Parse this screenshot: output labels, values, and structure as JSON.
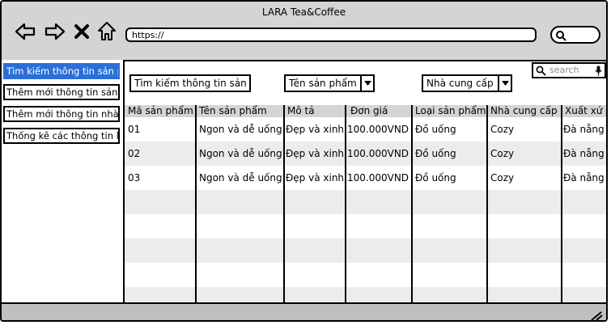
{
  "window": {
    "title": "LARA Tea&Coffee"
  },
  "toolbar": {
    "back_icon": "arrow-left-icon",
    "forward_icon": "arrow-right-icon",
    "close_icon": "x-icon",
    "home_icon": "home-icon",
    "address": "https://"
  },
  "sidebar": {
    "items": [
      {
        "label": "Tìm kiếm thông tin sản phẩm",
        "active": true
      },
      {
        "label": "Thêm mới thông tin sản phẩm",
        "active": false
      },
      {
        "label": "Thêm mới thông tin nhà cung cấp",
        "active": false
      },
      {
        "label": "Thống kê các thông tin liên quan",
        "active": false
      }
    ]
  },
  "search": {
    "placeholder": "search"
  },
  "filters": {
    "keyword": "Tìm kiếm thông tin sản phẩm",
    "name_select": "Tên sản phẩm",
    "supplier_select": "Nhà cung cấp"
  },
  "table": {
    "headers": [
      "Mã sản phẩm",
      "Tên sản phẩm",
      "Mô tả",
      "Đơn giá",
      "Loại sản phẩm",
      "Nhà cung cấp",
      "Xuất xứ"
    ],
    "rows": [
      [
        "01",
        "Ngon và dễ uống",
        "Đẹp và xinh",
        "100.000VND",
        "Đồ uống",
        "Cozy",
        "Đà nẵng"
      ],
      [
        "02",
        "Ngon và dễ uống",
        "Đẹp và xinh",
        "100.000VND",
        "Đồ uống",
        "Cozy",
        "Đà nẵng"
      ],
      [
        "03",
        "Ngon và dễ uống",
        "Đẹp và xinh",
        "100.000VND",
        "Đồ uống",
        "Cozy",
        "Đà nẵng"
      ]
    ]
  },
  "colors": {
    "accent": "#2b6fd6",
    "chrome": "#d4d4d4",
    "row_alt": "#ececec"
  }
}
